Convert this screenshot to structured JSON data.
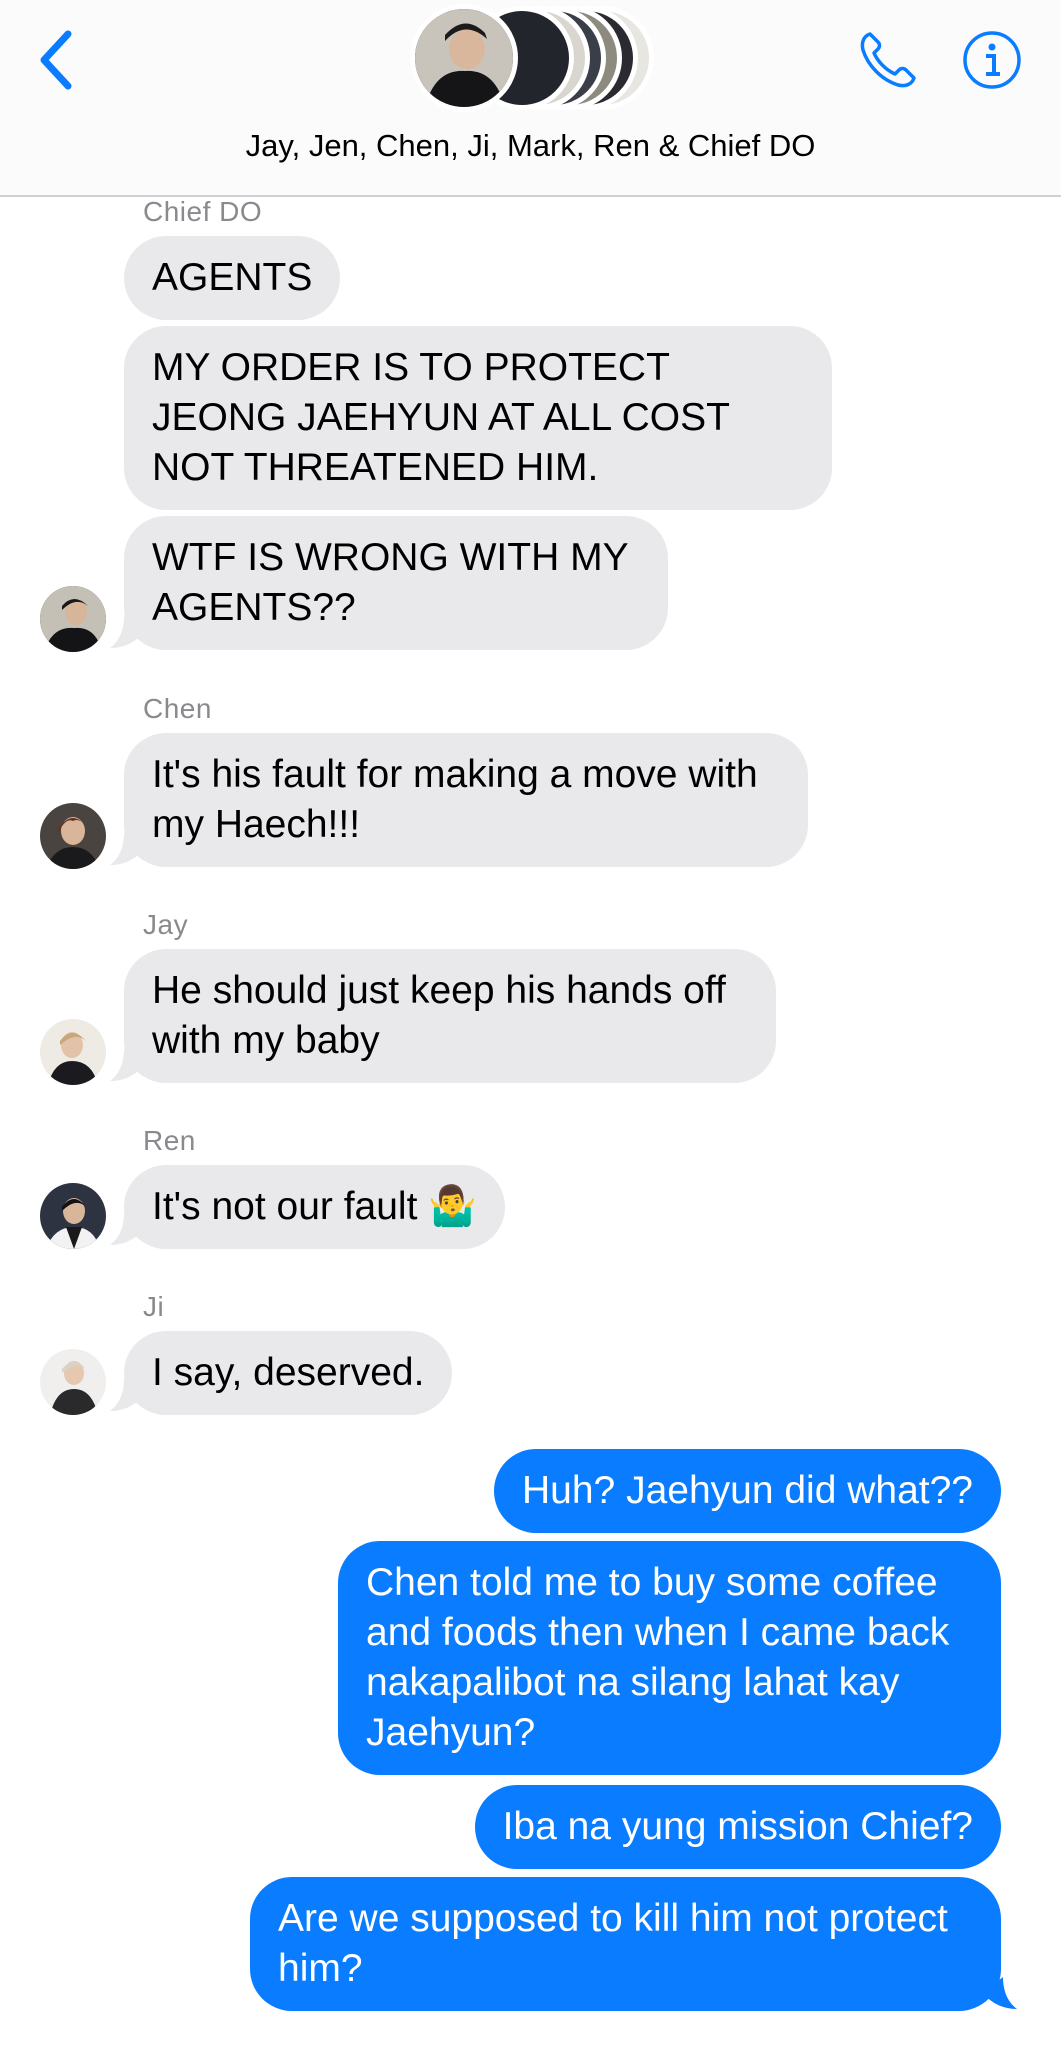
{
  "header": {
    "group_title": "Jay, Jen, Chen, Ji, Mark, Ren & Chief DO",
    "back_icon": "chevron-left-icon",
    "call_icon": "phone-icon",
    "info_icon": "info-icon",
    "accent_color": "#0a7cff"
  },
  "messages": [
    {
      "sender": "Chief DO",
      "text": "AGENTS"
    },
    {
      "text": "MY ORDER IS TO PROTECT JEONG JAEHYUN AT ALL COST NOT THREATENED HIM."
    },
    {
      "text": "WTF IS WRONG WITH MY AGENTS??"
    },
    {
      "sender": "Chen",
      "text": "It's his fault for making a move with my Haech!!!"
    },
    {
      "sender": "Jay",
      "text": "He should just keep his hands off with my baby"
    },
    {
      "sender": "Ren",
      "text": "It's not our fault 🤷‍♂️"
    },
    {
      "sender": "Ji",
      "text": "I say, deserved."
    },
    {
      "text": "Huh? Jaehyun did what??"
    },
    {
      "text": "Chen told me to buy some coffee and foods then when I came back nakapalibot na silang lahat kay Jaehyun?"
    },
    {
      "text": "Iba na yung mission Chief?"
    },
    {
      "text": "Are we supposed to kill him not protect him?"
    }
  ],
  "colors": {
    "incoming_bubble": "#e9e9eb",
    "outgoing_bubble": "#0a7cff",
    "sender_name": "#8a8a8e"
  }
}
